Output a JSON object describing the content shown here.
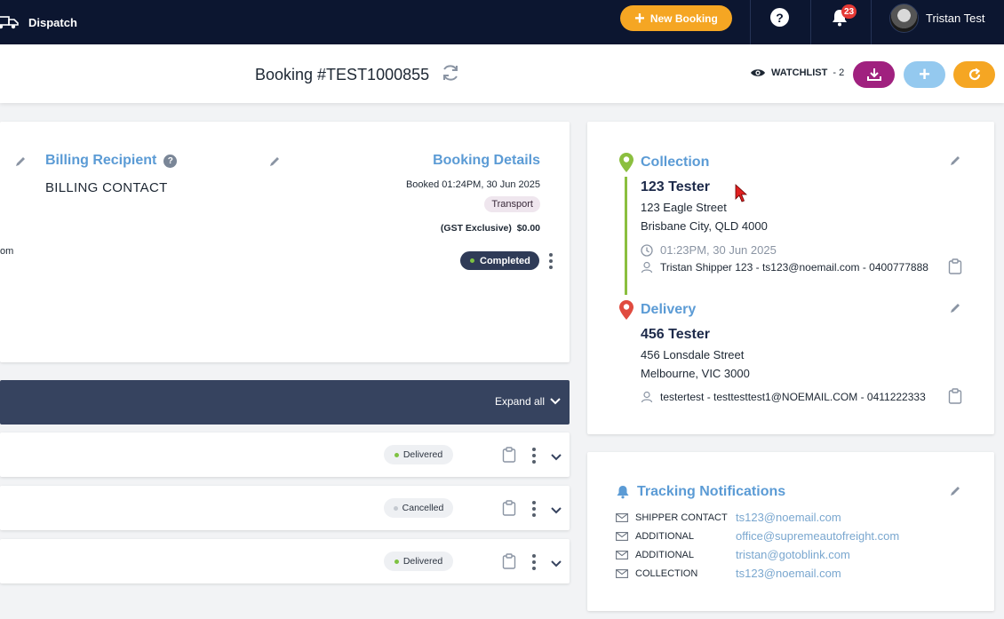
{
  "topbar": {
    "brand": "Dispatch",
    "new_booking": "New Booking",
    "help": "?",
    "notifications_count": "23",
    "user_name": "Tristan Test"
  },
  "subheader": {
    "booking_title": "Booking #TEST1000855",
    "watchlist_label": "WATCHLIST",
    "watchlist_count": "- 2",
    "add_label": "+"
  },
  "main": {
    "billing": {
      "title": "Billing Recipient",
      "help": "?",
      "contact": "BILLING CONTACT"
    },
    "left_fragment": "om",
    "booking_details": {
      "title": "Booking Details",
      "booked": "Booked 01:24PM, 30 Jun 2025",
      "type": "Transport",
      "gst_label": "(GST Exclusive)",
      "gst_amount": "$0.00",
      "status": "Completed"
    }
  },
  "items_bar": {
    "expand_all": "Expand all"
  },
  "rows": [
    {
      "status": "Delivered",
      "dot_color": "#7ec242"
    },
    {
      "status": "Cancelled",
      "dot_color": "#c4c9d0"
    },
    {
      "status": "Delivered",
      "dot_color": "#7ec242"
    }
  ],
  "route": {
    "collection": {
      "title": "Collection",
      "name": "123 Tester",
      "street": "123 Eagle Street",
      "city": "Brisbane City, QLD 4000",
      "time": "01:23PM, 30 Jun 2025",
      "contact": "Tristan Shipper 123 - ts123@noemail.com - 0400777888"
    },
    "delivery": {
      "title": "Delivery",
      "name": "456 Tester",
      "street": "456 Lonsdale Street",
      "city": "Melbourne, VIC 3000",
      "contact": "testertest - testtesttest1@NOEMAIL.COM - 0411222333"
    }
  },
  "tracking": {
    "title": "Tracking Notifications",
    "rows": [
      {
        "label": "SHIPPER CONTACT",
        "email": "ts123@noemail.com"
      },
      {
        "label": "ADDITIONAL",
        "email": "office@supremeautofreight.com"
      },
      {
        "label": "ADDITIONAL",
        "email": "tristan@gotoblink.com"
      },
      {
        "label": "COLLECTION",
        "email": "ts123@noemail.com"
      }
    ]
  },
  "colors": {
    "nav_bg": "#0c1630",
    "accent_orange": "#f5a623",
    "heading_blue": "#5b9bd5",
    "download_purple": "#a0217f",
    "route_green": "#8bbf3f",
    "delivery_red": "#e04b3f"
  }
}
